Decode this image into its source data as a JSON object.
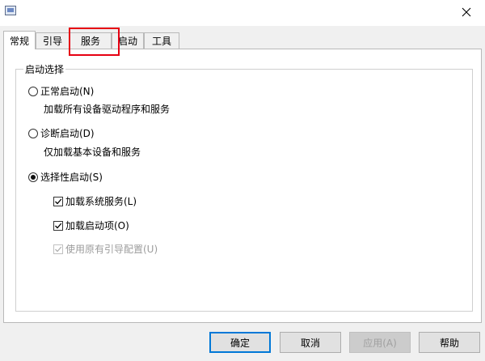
{
  "window": {
    "close_icon": "close-icon"
  },
  "tabs": [
    {
      "label": "常规",
      "active": true
    },
    {
      "label": "引导",
      "active": false
    },
    {
      "label": "服务",
      "active": false
    },
    {
      "label": "启动",
      "active": false
    },
    {
      "label": "工具",
      "active": false
    }
  ],
  "startup_selection": {
    "group_title": "启动选择",
    "normal": {
      "label": "正常启动(N)",
      "desc": "加载所有设备驱动程序和服务",
      "selected": false
    },
    "diagnostic": {
      "label": "诊断启动(D)",
      "desc": "仅加载基本设备和服务",
      "selected": false
    },
    "selective": {
      "label": "选择性启动(S)",
      "selected": true,
      "options": [
        {
          "label": "加载系统服务(L)",
          "checked": true,
          "enabled": true
        },
        {
          "label": "加载启动项(O)",
          "checked": true,
          "enabled": true
        },
        {
          "label": "使用原有引导配置(U)",
          "checked": true,
          "enabled": false
        }
      ]
    }
  },
  "buttons": {
    "ok": "确定",
    "cancel": "取消",
    "apply": "应用(A)",
    "help": "帮助"
  },
  "colors": {
    "highlight": "#e60012",
    "primary_border": "#0078d7"
  }
}
